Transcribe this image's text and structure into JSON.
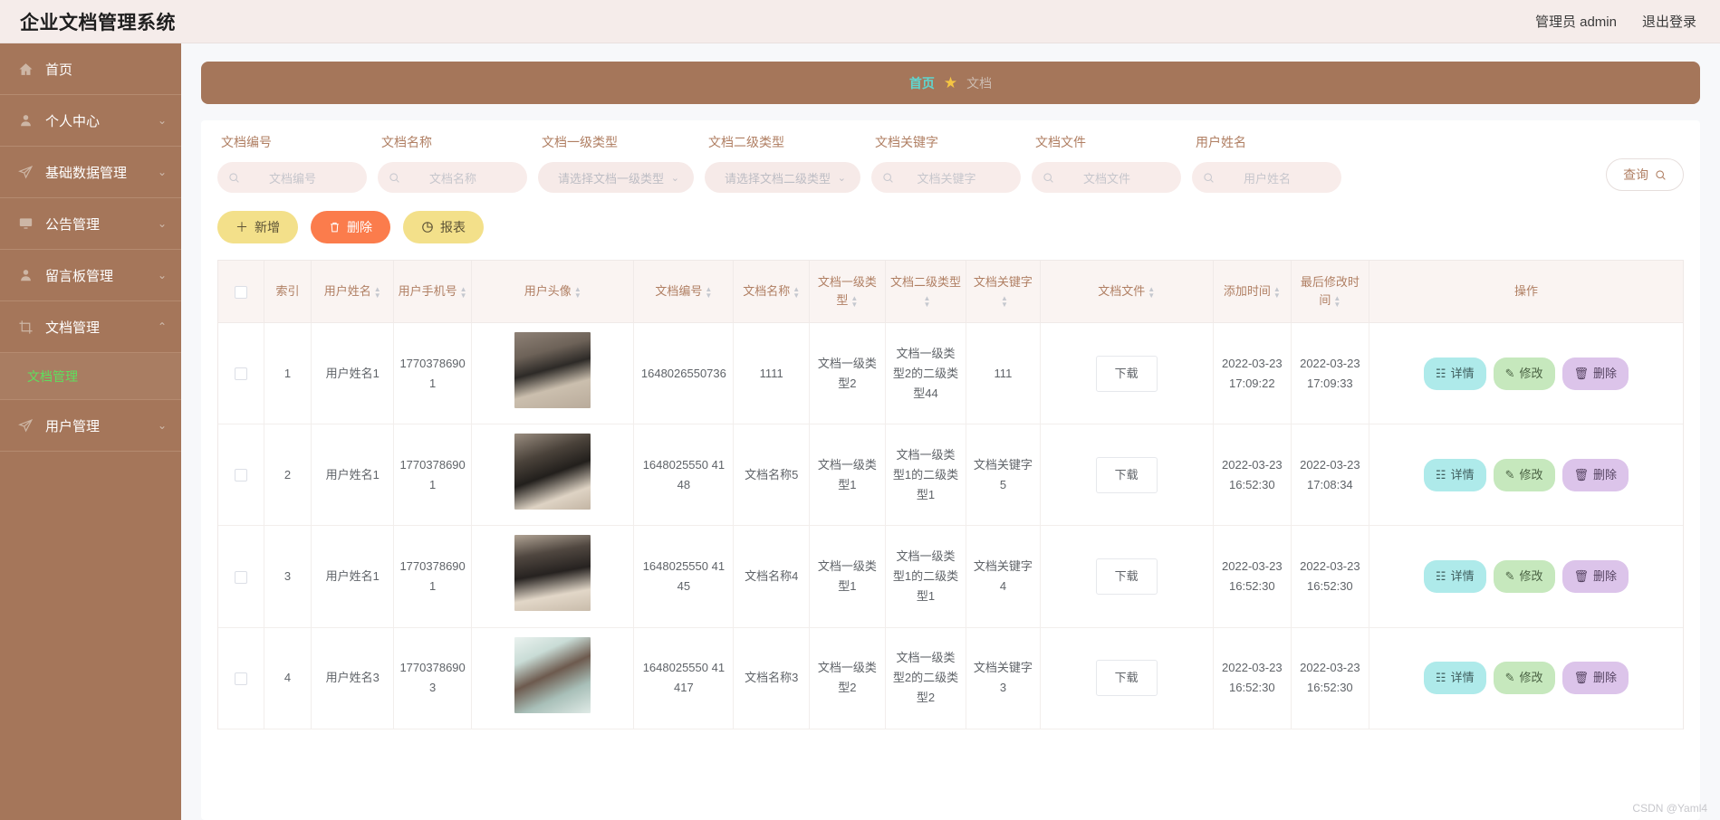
{
  "header": {
    "brand": "企业文档管理系统",
    "user_label": "管理员 admin",
    "logout_label": "退出登录"
  },
  "sidebar": {
    "items": [
      {
        "label": "首页",
        "icon": "home-icon",
        "expandable": false,
        "expanded": false
      },
      {
        "label": "个人中心",
        "icon": "user-icon",
        "expandable": true,
        "expanded": false
      },
      {
        "label": "基础数据管理",
        "icon": "send-icon",
        "expandable": true,
        "expanded": false
      },
      {
        "label": "公告管理",
        "icon": "monitor-icon",
        "expandable": true,
        "expanded": false
      },
      {
        "label": "留言板管理",
        "icon": "user-icon",
        "expandable": true,
        "expanded": false
      },
      {
        "label": "文档管理",
        "icon": "crop-icon",
        "expandable": true,
        "expanded": true
      },
      {
        "label": "用户管理",
        "icon": "send-icon",
        "expandable": true,
        "expanded": false
      }
    ],
    "submenu": [
      {
        "label": "文档管理",
        "active": true
      }
    ],
    "active_color": "#5ee05e",
    "background": "#a5765a"
  },
  "breadcrumb": {
    "home": "首页",
    "star": "★",
    "current": "文档"
  },
  "search": {
    "fields": [
      {
        "label": "文档编号",
        "placeholder": "文档编号",
        "type": "input",
        "value": ""
      },
      {
        "label": "文档名称",
        "placeholder": "文档名称",
        "type": "input",
        "value": ""
      },
      {
        "label": "文档一级类型",
        "placeholder": "请选择文档一级类型",
        "type": "select",
        "value": ""
      },
      {
        "label": "文档二级类型",
        "placeholder": "请选择文档二级类型",
        "type": "select",
        "value": ""
      },
      {
        "label": "文档关键字",
        "placeholder": "文档关键字",
        "type": "input",
        "value": ""
      },
      {
        "label": "文档文件",
        "placeholder": "文档文件",
        "type": "input",
        "value": ""
      },
      {
        "label": "用户姓名",
        "placeholder": "用户姓名",
        "type": "input",
        "value": ""
      }
    ],
    "query_label": "查询"
  },
  "toolbar": {
    "add_label": "新增",
    "delete_label": "删除",
    "report_label": "报表"
  },
  "table": {
    "columns": [
      {
        "label": "",
        "sortable": false,
        "key": "checkbox"
      },
      {
        "label": "索引",
        "sortable": false,
        "key": "index"
      },
      {
        "label": "用户姓名",
        "sortable": true,
        "key": "username"
      },
      {
        "label": "用户手机号",
        "sortable": true,
        "key": "phone"
      },
      {
        "label": "用户头像",
        "sortable": true,
        "key": "avatar"
      },
      {
        "label": "文档编号",
        "sortable": true,
        "key": "doc_no"
      },
      {
        "label": "文档名称",
        "sortable": true,
        "key": "doc_name"
      },
      {
        "label": "文档一级类型",
        "sortable": true,
        "key": "type1"
      },
      {
        "label": "文档二级类型",
        "sortable": true,
        "key": "type2"
      },
      {
        "label": "文档关键字",
        "sortable": true,
        "key": "keyword"
      },
      {
        "label": "文档文件",
        "sortable": true,
        "key": "file"
      },
      {
        "label": "添加时间",
        "sortable": true,
        "key": "created"
      },
      {
        "label": "最后修改时间",
        "sortable": true,
        "key": "modified"
      },
      {
        "label": "操作",
        "sortable": false,
        "key": "ops"
      }
    ],
    "download_label": "下载",
    "op_labels": {
      "detail": "详情",
      "edit": "修改",
      "delete": "删除"
    },
    "rows": [
      {
        "index": "1",
        "username": "用户姓名1",
        "phone": "17703786901",
        "avatar": "av1",
        "doc_no": "1648026550736",
        "doc_name": "1111",
        "type1": "文档一级类型2",
        "type2": "文档一级类型2的二级类型44",
        "keyword": "111",
        "file": "下载",
        "created": "2022-03-23 17:09:22",
        "modified": "2022-03-23 17:09:33"
      },
      {
        "index": "2",
        "username": "用户姓名1",
        "phone": "17703786901",
        "avatar": "av2",
        "doc_no": "1648025550 4148",
        "doc_name": "文档名称5",
        "type1": "文档一级类型1",
        "type2": "文档一级类型1的二级类型1",
        "keyword": "文档关键字5",
        "file": "下载",
        "created": "2022-03-23 16:52:30",
        "modified": "2022-03-23 17:08:34"
      },
      {
        "index": "3",
        "username": "用户姓名1",
        "phone": "17703786901",
        "avatar": "av3",
        "doc_no": "1648025550 4145",
        "doc_name": "文档名称4",
        "type1": "文档一级类型1",
        "type2": "文档一级类型1的二级类型1",
        "keyword": "文档关键字4",
        "file": "下载",
        "created": "2022-03-23 16:52:30",
        "modified": "2022-03-23 16:52:30"
      },
      {
        "index": "4",
        "username": "用户姓名3",
        "phone": "17703786903",
        "avatar": "av4",
        "doc_no": "1648025550 41417",
        "doc_name": "文档名称3",
        "type1": "文档一级类型2",
        "type2": "文档一级类型2的二级类型2",
        "keyword": "文档关键字3",
        "file": "下载",
        "created": "2022-03-23 16:52:30",
        "modified": "2022-03-23 16:52:30"
      }
    ]
  },
  "watermark": "CSDN @Yaml4",
  "colors": {
    "brand_brown": "#a5765a",
    "label_brown": "#b07f63",
    "accent_yellow": "#f3e08a",
    "accent_orange": "#fb7c4c",
    "detail_cyan": "#aeeaea",
    "edit_green": "#c6e8bd",
    "delete_purple": "#dcc4ea"
  }
}
